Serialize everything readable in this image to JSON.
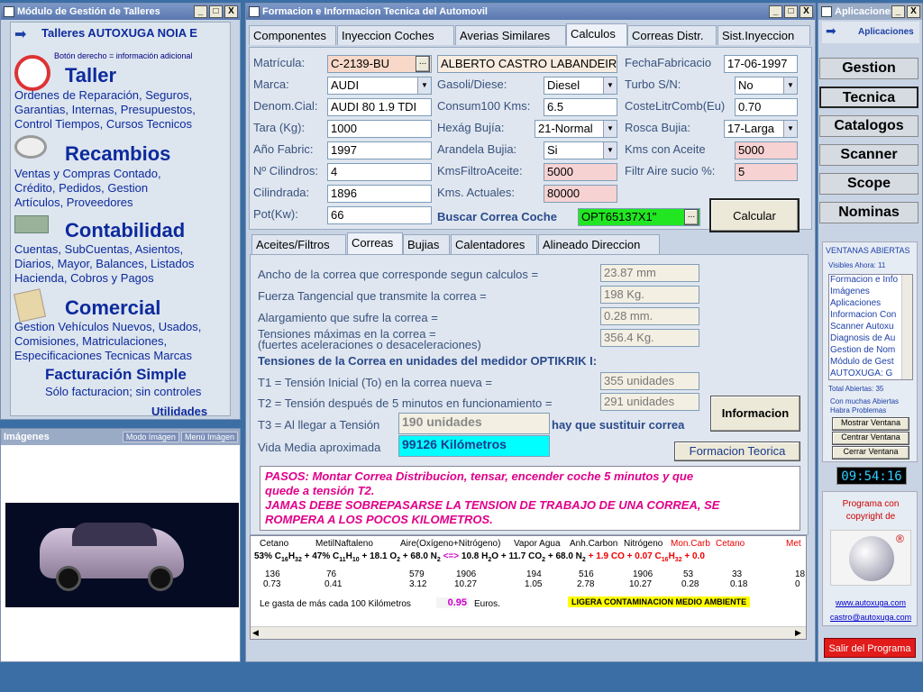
{
  "left_window": {
    "title": "Módulo de Gestión de Talleres",
    "min": "_",
    "max": "□",
    "close": "X",
    "brand": "Talleres AUTOXUGA NOIA E",
    "hint": "Botón derecho = información adicional",
    "sections": [
      {
        "title": "Taller",
        "desc": [
          "Ordenes de Reparación, Seguros,",
          "Garantias, Internas, Presupuestos,",
          "Control Tiempos, Cursos Tecnicos"
        ]
      },
      {
        "title": "Recambios",
        "desc": [
          "Ventas y Compras Contado,",
          "Crédito, Pedidos, Gestion",
          "Artículos, Proveedores"
        ]
      },
      {
        "title": "Contabilidad",
        "desc": [
          "Cuentas, SubCuentas, Asientos,",
          "Diarios, Mayor, Balances, Listados",
          "Hacienda, Cobros y Pagos"
        ]
      },
      {
        "title": "Comercial",
        "desc": [
          "Gestion Vehículos Nuevos, Usados,",
          "Comisiones, Matriculaciones,",
          "Especificaciones Tecnicas Marcas"
        ]
      }
    ],
    "fact_title": "Facturación Simple",
    "fact_desc": "Sólo facturacion; sin controles",
    "utilidades": "Utilidades"
  },
  "images_panel": {
    "title": "Imágenes",
    "mode_btn": "Modo Imágen",
    "menu_btn": "Menú Imágen"
  },
  "main_window": {
    "title": "Formacion e Informacion Tecnica del Automovil",
    "min": "_",
    "max": "□",
    "close": "X",
    "tabs": [
      "Componentes",
      "Inyeccion Coches",
      "Averias Similares",
      "Calculos",
      "Correas Distr.",
      "Sist.Inyeccion"
    ],
    "col1": [
      {
        "label": "Matrícula:",
        "value": "C-2139-BU"
      },
      {
        "label": "Marca:",
        "value": "AUDI"
      },
      {
        "label": "Denom.Cial:",
        "value": "AUDI 80 1.9 TDI"
      },
      {
        "label": "Tara (Kg):",
        "value": "1000"
      },
      {
        "label": "Año Fabric:",
        "value": "1997"
      },
      {
        "label": "Nº Cilindros:",
        "value": "4"
      },
      {
        "label": "Cilindrada:",
        "value": "1896"
      },
      {
        "label": "Pot(Kw):",
        "value": "66"
      }
    ],
    "owner": "ALBERTO CASTRO LABANDEIR",
    "col2": [
      {
        "label": "Gasoli/Diese:",
        "value": "Diesel"
      },
      {
        "label": "Consum100 Kms:",
        "value": "6.5"
      },
      {
        "label": "Hexág Bujía:",
        "value": "21-Normal"
      },
      {
        "label": "Arandela Bujia:",
        "value": "Si"
      },
      {
        "label": "KmsFiltroAceite:",
        "value": "5000"
      },
      {
        "label": "Kms. Actuales:",
        "value": "80000"
      }
    ],
    "col3": [
      {
        "label": "FechaFabricacio",
        "value": "17-06-1997"
      },
      {
        "label": "Turbo S/N:",
        "value": "No"
      },
      {
        "label": "CosteLitrComb(Eu)",
        "value": "0.70"
      },
      {
        "label": "Rosca Bujia:",
        "value": "17-Larga"
      },
      {
        "label": "Kms con Aceite",
        "value": "5000"
      },
      {
        "label": "Filtr Aire sucio %:",
        "value": "5"
      }
    ],
    "buscar_label": "Buscar Correa Coche",
    "buscar_value": "OPT65137X1\"",
    "calcular": "Calcular",
    "dots": "...",
    "subtabs": [
      "Aceites/Filtros",
      "Correas",
      "Bujias",
      "Calentadores",
      "Alineado Direccion"
    ],
    "results": [
      {
        "label": "Ancho de la correa que corresponde segun calculos =",
        "value": "23.87 mm"
      },
      {
        "label": "Fuerza Tangencial que transmite la correa =",
        "value": "198 Kg."
      },
      {
        "label": "Alargamiento que sufre la correa =",
        "value": "0.28 mm."
      },
      {
        "label": "Tensiones máximas en la correa =",
        "label2": "(fuertes aceleraciones o desaceleraciones)",
        "value": "356.4 Kg."
      }
    ],
    "tension_title": "Tensiones de la Correa en unidades del medidor OPTIKRIK I:",
    "t1_label": "T1 = Tensión Inicial (To) en la correa nueva =",
    "t1_value": "355 unidades",
    "t2_label": "T2 = Tensión después de 5 minutos en funcionamiento =",
    "t2_value": "291 unidades",
    "t3_label": "T3 = Al llegar a Tensión",
    "t3_value": "190 unidades",
    "t3_suffix": "hay que sustituir correa",
    "vida_label": "Vida Media aproximada",
    "vida_value": "99126 Kilómetros",
    "informacion": "Informacion",
    "formacion": "Formacion Teorica",
    "pasos": [
      "PASOS: Montar Correa Distribucion, tensar, encender coche 5 minutos y que",
      "quede a tensión T2.",
      "JAMAS DEBE SOBREPASARSE LA TENSION DE TRABAJO DE UNA CORREA, SE",
      "ROMPERA A LOS POCOS KILOMETROS."
    ],
    "chem_headers": [
      "Cetano",
      "MetilNaftaleno",
      "Aire(Oxígeno+Nitrógeno)",
      "Vapor Agua",
      "Anh.Carbon",
      "Nitrógeno",
      "Mon.Carb",
      "Cetano",
      "Met"
    ],
    "chem_row1": [
      "136",
      "76",
      "579",
      "1906",
      "194",
      "516",
      "1906",
      "53",
      "33",
      "18"
    ],
    "chem_row2": [
      "0.73",
      "0.41",
      "3.12",
      "10.27",
      "1.05",
      "2.78",
      "10.27",
      "0.28",
      "0.18",
      "0"
    ],
    "gasta_label": "Le gasta de más cada 100 Kilómetros",
    "gasta_value": "0.95",
    "gasta_unit": "Euros.",
    "contam": "LIGERA CONTAMINACION MEDIO AMBIENTE"
  },
  "right_window": {
    "title": "Aplicaciones",
    "min": "_",
    "close": "X",
    "header": "Aplicaciones",
    "buttons": [
      "Gestion",
      "Tecnica",
      "Catalogos",
      "Scanner",
      "Scope",
      "Nominas"
    ],
    "ventanas_title": "VENTANAS ABIERTAS",
    "visibles": "Visibles Ahora: 11",
    "list": [
      "Formacion e Info",
      "Imágenes",
      "Aplicaciones",
      "Informacion Con",
      "Scanner Autoxu",
      "Diagnosis de Au",
      "Gestion de Nom",
      "Módulo de Gest",
      "AUTOXUGA: G"
    ],
    "total": "Total Abiertas: 35",
    "warn1": "Con muchas Abiertas",
    "warn2": "Habra Problemas",
    "mostrar": "Mostrar Ventana",
    "centrar": "Centrar Ventana",
    "cerrar": "Cerrar Ventana",
    "clock": "09:54:16",
    "copyright1": "Programa con",
    "copyright2": "copyright de",
    "reg": "®",
    "web": "www.autoxuga.com",
    "email": "castro@autoxuga.com",
    "salir": "Salir del Programa"
  }
}
